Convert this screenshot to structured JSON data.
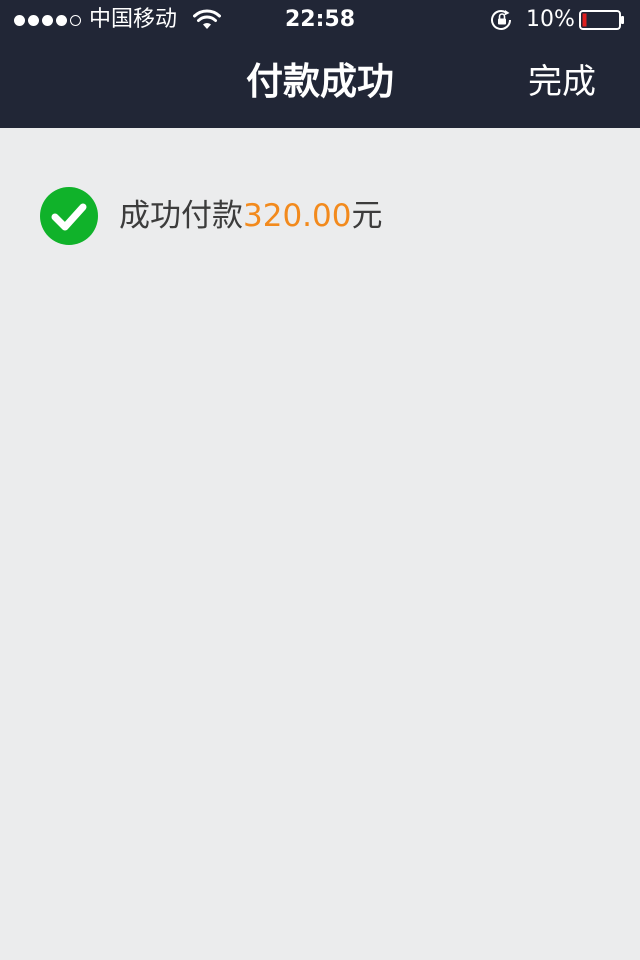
{
  "status_bar": {
    "signal_bars": 4,
    "signal_total": 5,
    "carrier": "中国移动",
    "time": "22:58",
    "battery_percent": "10%",
    "battery_level": 0.1,
    "icons": [
      "signal-dots-icon",
      "wifi-icon",
      "rotation-lock-icon",
      "battery-icon"
    ]
  },
  "nav": {
    "title": "付款成功",
    "done_label": "完成"
  },
  "result": {
    "prefix": "成功付款",
    "amount": "320.00",
    "suffix": "元",
    "icon": "success-check-icon"
  },
  "colors": {
    "nav_background": "#212636",
    "page_background": "#ebeced",
    "success_green": "#10b22a",
    "amount_orange": "#f28a1d",
    "battery_low_red": "#e02020"
  }
}
